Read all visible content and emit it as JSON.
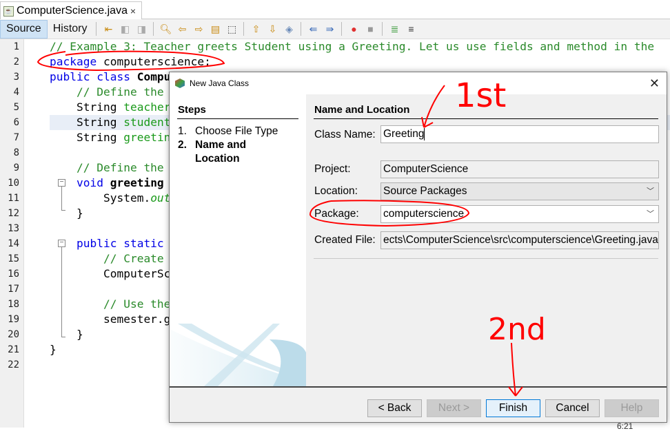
{
  "editor_tab": {
    "filename": "ComputerScience.java",
    "close": "×"
  },
  "toolbar": {
    "source": "Source",
    "history": "History"
  },
  "code_lines": [
    {
      "n": "1"
    },
    {
      "n": "2"
    },
    {
      "n": "3"
    },
    {
      "n": "4"
    },
    {
      "n": "5"
    },
    {
      "n": "6"
    },
    {
      "n": "7"
    },
    {
      "n": "8"
    },
    {
      "n": "9"
    },
    {
      "n": "10"
    },
    {
      "n": "11"
    },
    {
      "n": "12"
    },
    {
      "n": "13"
    },
    {
      "n": "14"
    },
    {
      "n": "15"
    },
    {
      "n": "16"
    },
    {
      "n": "17"
    },
    {
      "n": "18"
    },
    {
      "n": "19"
    },
    {
      "n": "20"
    },
    {
      "n": "21"
    },
    {
      "n": "22"
    }
  ],
  "code": {
    "l1": "// Example 3: Teacher greets Student using a Greeting. Let us use fields and method in the",
    "l2_kw": "package",
    "l2_rest": " computerscience;",
    "l3_kw": "public class",
    "l3_name": " ComputerScience",
    "l4": "    // Define the",
    "l5_type": "    String",
    "l5_field": " teacher",
    "l6_type": "    String",
    "l6_field": " student",
    "l7_type": "    String",
    "l7_field": " greeting",
    "l9": "    // Define the",
    "l10_kw": "    void",
    "l10_name": " greeting",
    "l11_a": "        System.",
    "l11_b": "out",
    "l12": "    }",
    "l14_kw": "    public static",
    "l15": "        // Create",
    "l16": "        ComputerScience",
    "l18": "        // Use the",
    "l19": "        semester.g",
    "l20": "    }",
    "l21": "}"
  },
  "dialog": {
    "title": "New Java Class",
    "steps_title": "Steps",
    "steps": [
      "1.",
      "Choose File Type",
      "2.",
      "Name and",
      "Location"
    ],
    "section_title": "Name and Location",
    "class_name_label": "Class Name:",
    "class_name_value": "Greeting",
    "project_label": "Project:",
    "project_value": "ComputerScience",
    "location_label": "Location:",
    "location_value": "Source Packages",
    "package_label": "Package:",
    "package_value": "computerscience",
    "created_file_label": "Created File:",
    "created_file_value": "ects\\ComputerScience\\src\\computerscience\\Greeting.java",
    "buttons": {
      "back": "< Back",
      "next": "Next >",
      "finish": "Finish",
      "cancel": "Cancel",
      "help": "Help"
    }
  },
  "annotations": {
    "first": "1st",
    "second": "2nd",
    "color": "#ff0000"
  },
  "status": {
    "position": "6:21"
  }
}
